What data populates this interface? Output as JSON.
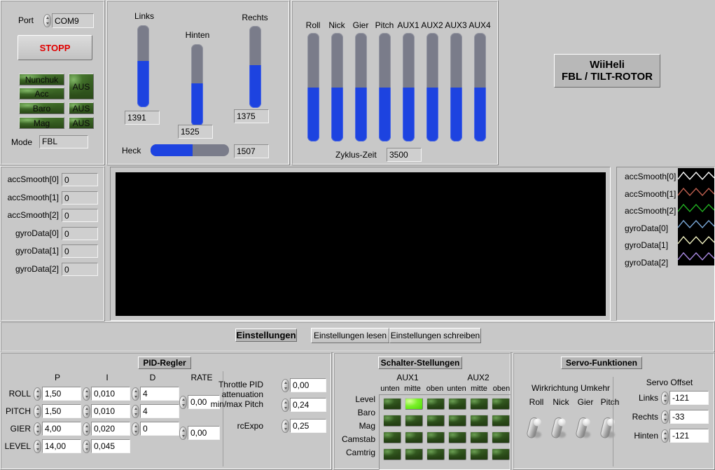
{
  "app": {
    "title_line1": "WiiHeli",
    "title_line2": "FBL / TILT-ROTOR",
    "background": "#c8c8c8",
    "accent_blue": "#1d43e0",
    "led_on": "#7bf02a"
  },
  "connection": {
    "port_label": "Port",
    "port_value": "COM9",
    "stop_label": "STOPP",
    "mode_label": "Mode",
    "mode_value": "FBL",
    "sensors": [
      {
        "name": "Nunchuk",
        "state": "AUS"
      },
      {
        "name": "Acc",
        "state": "AUS"
      },
      {
        "name": "Baro",
        "state": "AUS"
      },
      {
        "name": "Mag",
        "state": "AUS"
      }
    ],
    "state_labels": [
      "AUS",
      "AUS",
      "AUS"
    ]
  },
  "servos": {
    "links": {
      "label": "Links",
      "value": "1391",
      "fill_pct": 56
    },
    "hinten": {
      "label": "Hinten",
      "value": "1525",
      "fill_pct": 52
    },
    "rechts": {
      "label": "Rechts",
      "value": "1375",
      "fill_pct": 52
    },
    "heck": {
      "label": "Heck",
      "value": "1507",
      "fill_pct": 54
    }
  },
  "rc": {
    "channels": [
      {
        "label": "Roll",
        "fill_pct": 50
      },
      {
        "label": "Nick",
        "fill_pct": 50
      },
      {
        "label": "Gier",
        "fill_pct": 50
      },
      {
        "label": "Pitch",
        "fill_pct": 50
      },
      {
        "label": "AUX1",
        "fill_pct": 50
      },
      {
        "label": "AUX2",
        "fill_pct": 50
      },
      {
        "label": "AUX3",
        "fill_pct": 50
      },
      {
        "label": "AUX4",
        "fill_pct": 50
      }
    ],
    "cycle_label": "Zyklus-Zeit",
    "cycle_value": "3500"
  },
  "sensor_values": [
    {
      "label": "accSmooth[0]",
      "value": "0"
    },
    {
      "label": "accSmooth[1]",
      "value": "0"
    },
    {
      "label": "accSmooth[2]",
      "value": "0"
    },
    {
      "label": "gyroData[0]",
      "value": "0"
    },
    {
      "label": "gyroData[1]",
      "value": "0"
    },
    {
      "label": "gyroData[2]",
      "value": "0"
    }
  ],
  "legend": [
    {
      "label": "accSmooth[0]",
      "color": "#ffffff"
    },
    {
      "label": "accSmooth[1]",
      "color": "#c06050"
    },
    {
      "label": "accSmooth[2]",
      "color": "#22b022"
    },
    {
      "label": "gyroData[0]",
      "color": "#7aa8d8"
    },
    {
      "label": "gyroData[1]",
      "color": "#f0f0c0"
    },
    {
      "label": "gyroData[2]",
      "color": "#a888e0"
    }
  ],
  "settings_bar": {
    "title": "Einstellungen",
    "read_label": "Einstellungen lesen",
    "write_label": "Einstellungen schreiben"
  },
  "pid": {
    "title": "PID-Regler",
    "columns": [
      "P",
      "I",
      "D",
      "RATE"
    ],
    "rows": [
      {
        "name": "ROLL",
        "p": "1,50",
        "i": "0,010",
        "d": "4",
        "rate": "0,00"
      },
      {
        "name": "PITCH",
        "p": "1,50",
        "i": "0,010",
        "d": "4",
        "rate": ""
      },
      {
        "name": "GIER",
        "p": "4,00",
        "i": "0,020",
        "d": "0",
        "rate": "0,00"
      },
      {
        "name": "LEVEL",
        "p": "14,00",
        "i": "0,045",
        "d": "",
        "rate": ""
      }
    ],
    "extras": [
      {
        "label_l1": "Throttle PID",
        "label_l2": "attenuation",
        "value": "0,00"
      },
      {
        "label_l1": "min/max Pitch",
        "label_l2": "",
        "value": "0,24"
      },
      {
        "label_l1": "rcExpo",
        "label_l2": "",
        "value": "0,25"
      }
    ]
  },
  "switches": {
    "title": "Schalter-Stellungen",
    "groups": [
      "AUX1",
      "AUX2"
    ],
    "positions": [
      "unten",
      "mitte",
      "oben"
    ],
    "rows": [
      "Level",
      "Baro",
      "Mag",
      "Camstab",
      "Camtrig"
    ],
    "active": [
      [
        0,
        1
      ]
    ]
  },
  "servo_functions": {
    "title": "Servo-Funktionen",
    "reverse_title": "Wirkrichtung Umkehr",
    "reverse_axes": [
      "Roll",
      "Nick",
      "Gier",
      "Pitch"
    ],
    "offset_title": "Servo Offset",
    "offsets": [
      {
        "label": "Links",
        "value": "-121"
      },
      {
        "label": "Rechts",
        "value": "-33"
      },
      {
        "label": "Hinten",
        "value": "-121"
      }
    ]
  }
}
